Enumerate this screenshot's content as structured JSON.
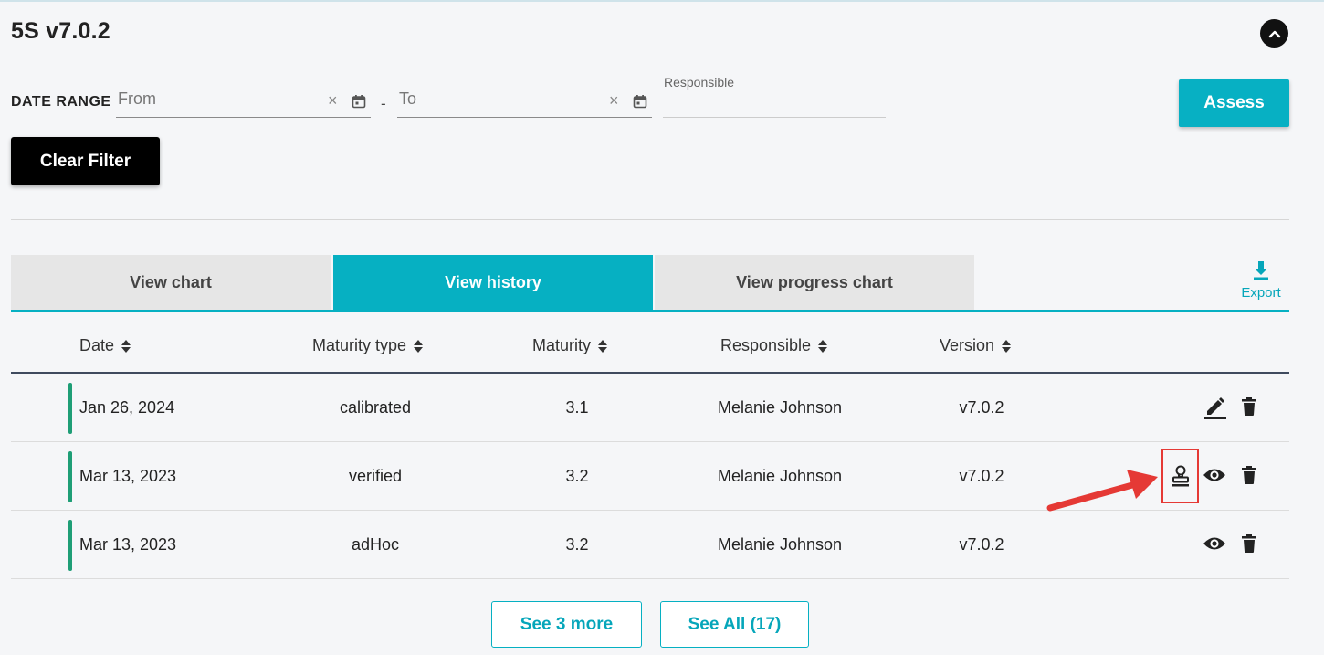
{
  "page_title": "5S v7.0.2",
  "filters": {
    "date_range_label": "DATE RANGE",
    "from_placeholder": "From",
    "to_placeholder": "To",
    "range_separator": "-",
    "responsible_label": "Responsible",
    "responsible_value": "",
    "clear_symbol": "×"
  },
  "buttons": {
    "assess": "Assess",
    "clear_filter": "Clear Filter",
    "see_more": "See 3 more",
    "see_all": "See All (17)"
  },
  "tabs": [
    {
      "label": "View chart",
      "active": false
    },
    {
      "label": "View history",
      "active": true
    },
    {
      "label": "View progress chart",
      "active": false
    }
  ],
  "export": {
    "label": "Export",
    "icon": "download-icon"
  },
  "table": {
    "columns": [
      "Date",
      "Maturity type",
      "Maturity",
      "Responsible",
      "Version"
    ],
    "rows": [
      {
        "date": "Jan 26, 2024",
        "maturity_type": "calibrated",
        "maturity": "3.1",
        "responsible": "Melanie Johnson",
        "version": "v7.0.2",
        "actions": [
          "edit-icon",
          "delete-icon"
        ]
      },
      {
        "date": "Mar 13, 2023",
        "maturity_type": "verified",
        "maturity": "3.2",
        "responsible": "Melanie Johnson",
        "version": "v7.0.2",
        "actions": [
          "stamp-icon",
          "view-icon",
          "delete-icon"
        ]
      },
      {
        "date": "Mar 13, 2023",
        "maturity_type": "adHoc",
        "maturity": "3.2",
        "responsible": "Melanie Johnson",
        "version": "v7.0.2",
        "actions": [
          "view-icon",
          "delete-icon"
        ]
      }
    ]
  },
  "colors": {
    "accent": "#06b0c2",
    "row_marker": "#1e9e76",
    "annotation": "#e53935",
    "background": "#f5f6f8"
  }
}
